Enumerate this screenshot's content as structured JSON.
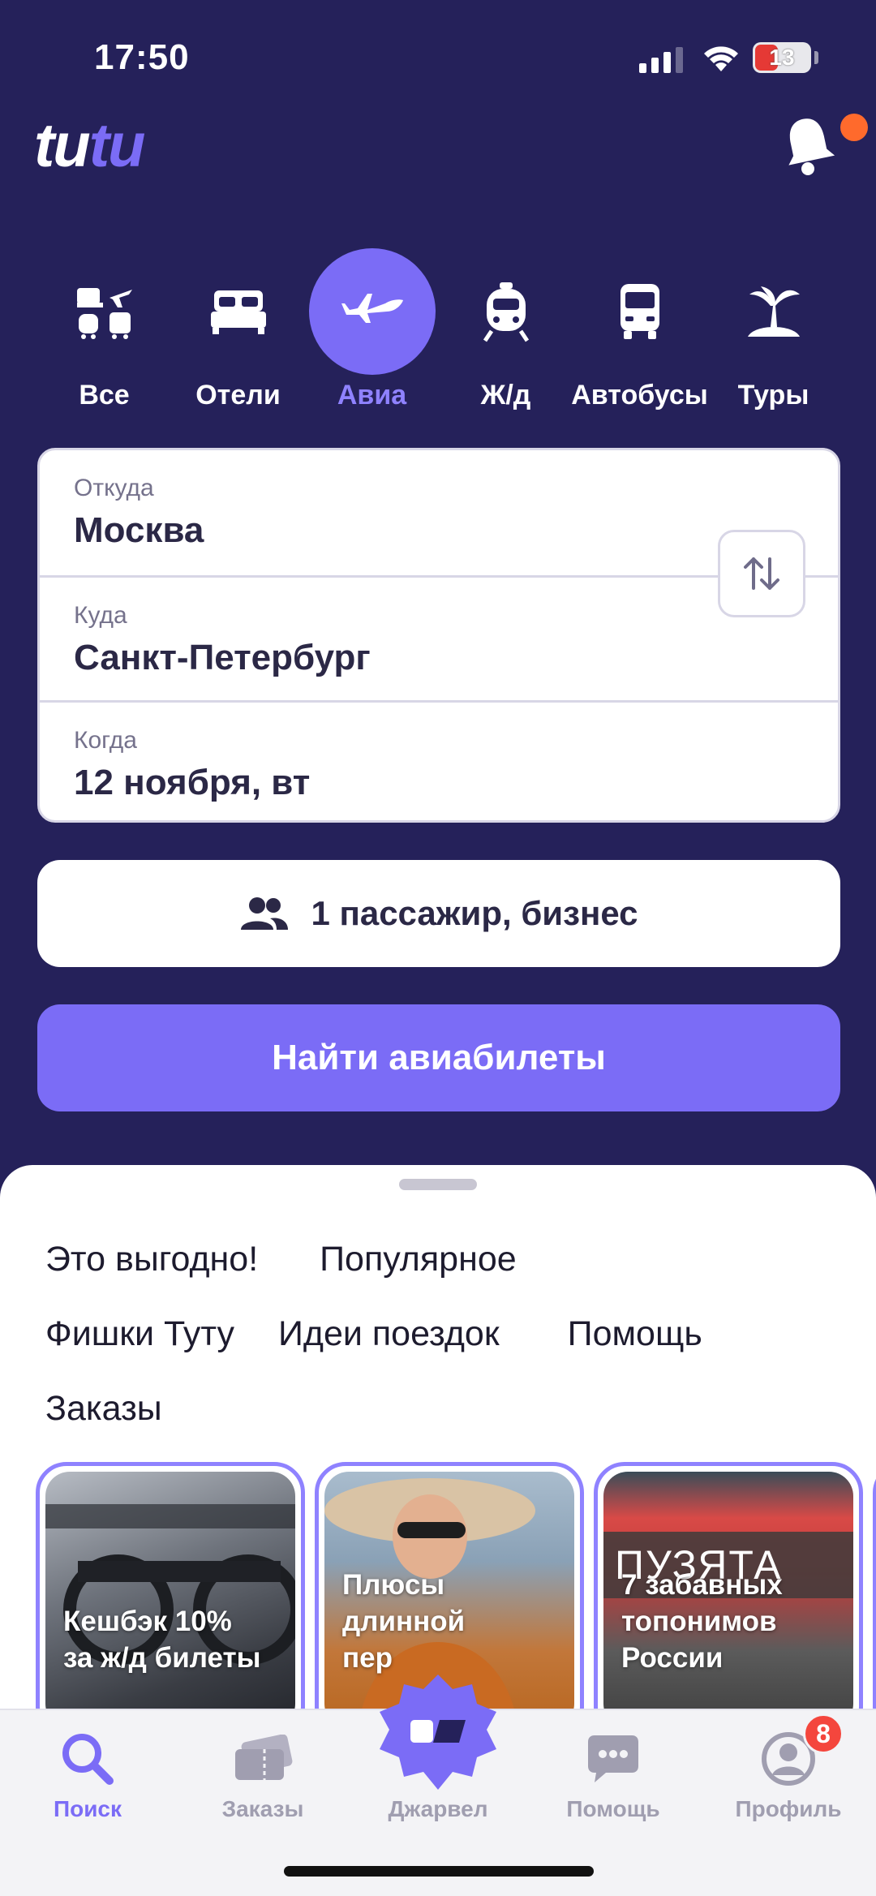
{
  "status": {
    "time": "17:50",
    "battery": "13"
  },
  "categories": [
    {
      "label": "Все",
      "icon": "all-transport-icon"
    },
    {
      "label": "Отели",
      "icon": "bed-icon"
    },
    {
      "label": "Авиа",
      "icon": "airplane-icon",
      "active": true
    },
    {
      "label": "Ж/д",
      "icon": "train-icon"
    },
    {
      "label": "Автобусы",
      "icon": "bus-icon"
    },
    {
      "label": "Туры",
      "icon": "palm-island-icon"
    }
  ],
  "form": {
    "from_label": "Откуда",
    "from_value": "Москва",
    "to_label": "Куда",
    "to_value": "Санкт-Петербург",
    "when_label": "Когда",
    "when_value": "12 ноября, вт"
  },
  "passengers": "1 пассажир, бизнес",
  "find_button": "Найти авиабилеты",
  "chips": [
    "Это выгодно!",
    "Популярное",
    "Фишки Туту",
    "Идеи поездок",
    "Помощь",
    "Заказы"
  ],
  "stories": [
    {
      "text_1": "Кешбэк 10%",
      "text_2": "за ж/д билеты"
    },
    {
      "text_1": "Плюсы",
      "text_2": "длинной",
      "text_3": "пер"
    },
    {
      "banner": "ПУЗЯТА",
      "text_1": "7 забавных",
      "text_2": "топонимов",
      "text_3": "России"
    }
  ],
  "tabs": [
    {
      "label": "Поиск",
      "icon": "search-icon",
      "active": true
    },
    {
      "label": "Заказы",
      "icon": "tickets-icon"
    },
    {
      "label": "Джарвел",
      "icon": "jravel-icon"
    },
    {
      "label": "Помощь",
      "icon": "chat-icon"
    },
    {
      "label": "Профиль",
      "icon": "profile-icon",
      "badge": "8"
    }
  ],
  "colors": {
    "background": "#25215a",
    "accent": "#7b6cf6",
    "notification": "#ff6a2c"
  }
}
